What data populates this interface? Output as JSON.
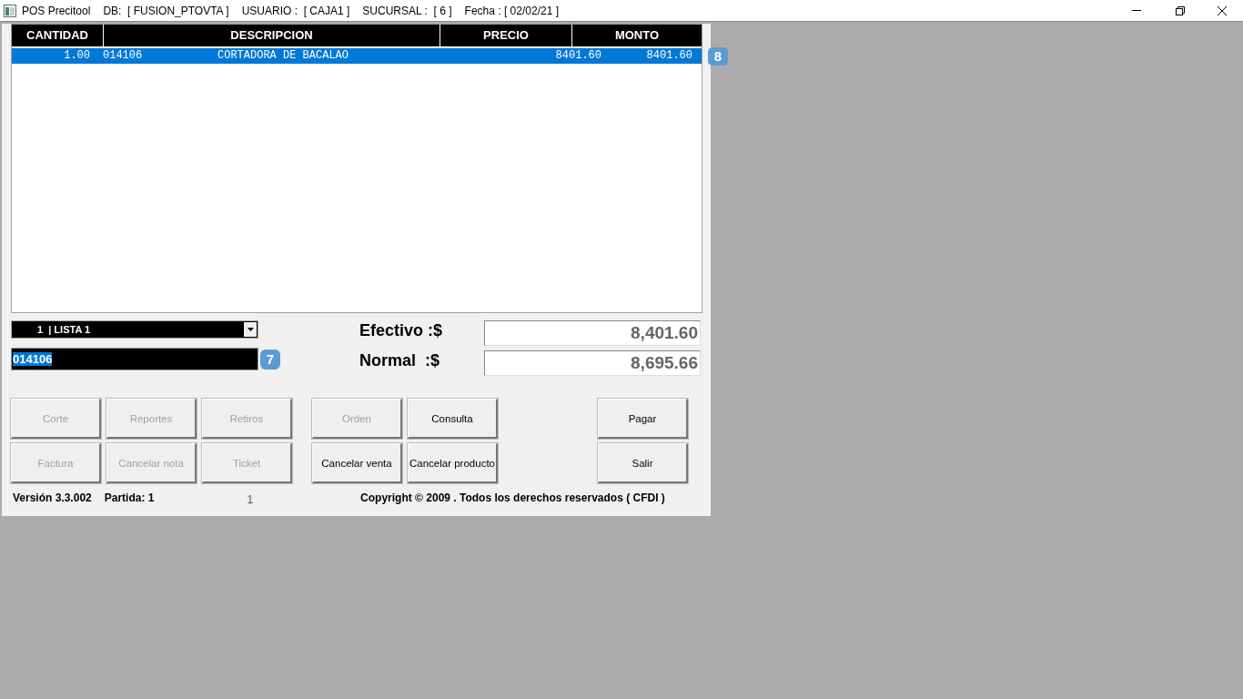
{
  "window": {
    "title_parts": [
      "POS Precitool",
      "DB:  [ FUSION_PTOVTA ]",
      "USUARIO :  [ CAJA1 ]",
      "SUCURSAL :  [ 6 ]",
      "Fecha : [ 02/02/21 ]"
    ]
  },
  "table": {
    "columns": [
      "CANTIDAD",
      "DESCRIPCION",
      "PRECIO",
      "MONTO"
    ],
    "rows": [
      {
        "cantidad": "1.00",
        "codigo": "014106",
        "descripcion": "CORTADORA DE BACALAO",
        "precio": "8401.60",
        "monto": "8401.60",
        "selected": true
      }
    ],
    "marker": "8"
  },
  "price_list": {
    "value": "1  | LISTA 1"
  },
  "code_field": {
    "value": "014106",
    "marker": "7"
  },
  "totals": [
    {
      "label": "Efectivo :$",
      "value": "8,401.60"
    },
    {
      "label": "Normal  :$",
      "value": "8,695.66"
    }
  ],
  "buttons": [
    {
      "label": "Corte",
      "disabled": true
    },
    {
      "label": "Reportes",
      "disabled": true
    },
    {
      "label": "Retiros",
      "disabled": true
    },
    {
      "label": "Orden",
      "disabled": true
    },
    {
      "label": "Consulta",
      "disabled": false
    },
    {
      "label": "Pagar",
      "disabled": false
    },
    {
      "label": "Factura",
      "disabled": true
    },
    {
      "label": "Cancelar nota",
      "disabled": true
    },
    {
      "label": "Ticket",
      "disabled": true
    },
    {
      "label": "Cancelar venta",
      "disabled": false
    },
    {
      "label": "Cancelar producto",
      "disabled": false
    },
    {
      "label": "Salir",
      "disabled": false
    }
  ],
  "status": {
    "version": "Versión 3.3.002",
    "partida": "Partida: 1",
    "count": "1",
    "copyright": "Copyright © 2009 . Todos los derechos reservados ( CFDI )"
  }
}
